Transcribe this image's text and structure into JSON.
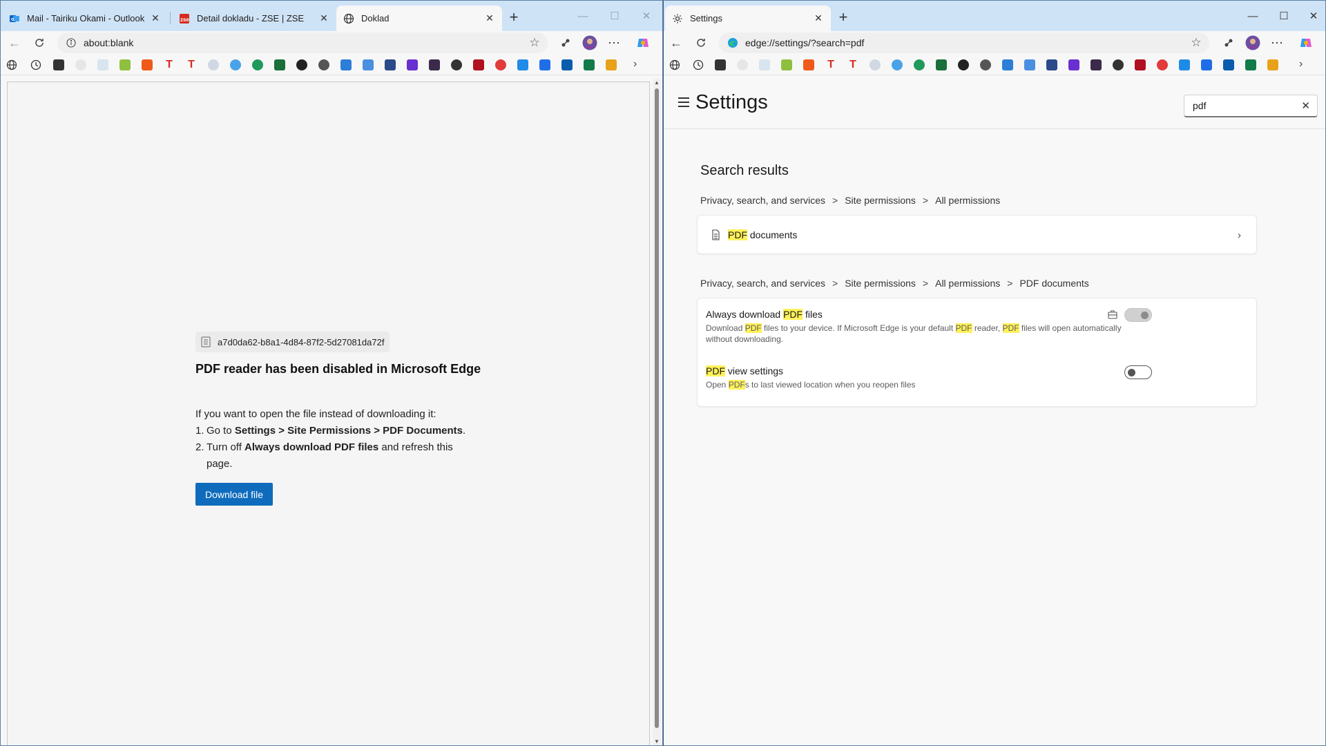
{
  "left_window": {
    "tabs": [
      {
        "title": "Mail - Tairiku Okami - Outlook",
        "icon": "outlook-icon",
        "active": false
      },
      {
        "title": "Detail dokladu - ZSE | ZSE",
        "icon": "zse-icon",
        "active": false
      },
      {
        "title": "Doklad",
        "icon": "globe-icon",
        "active": true
      }
    ],
    "address": "about:blank",
    "file_name": "a7d0da62-b8a1-4d84-87f2-5d27081da72f",
    "heading": "PDF reader has been disabled in Microsoft Edge",
    "intro": "If you want to open the file instead of downloading it:",
    "step1": {
      "num": "1.",
      "pre": "Go to ",
      "b1": "Settings",
      "s1": " > ",
      "b2": "Site Permissions",
      "s2": " > ",
      "b3": "PDF Documents",
      "end": "."
    },
    "step2": {
      "num": "2.",
      "pre": "Turn off ",
      "b1": "Always download PDF files",
      "end": " and refresh this page."
    },
    "download_button": "Download file"
  },
  "right_window": {
    "tabs": [
      {
        "title": "Settings",
        "icon": "gear-icon",
        "active": true
      }
    ],
    "address": "edge://settings/?search=pdf",
    "settings_title": "Settings",
    "search_value": "pdf",
    "results_heading": "Search results",
    "crumb1": [
      "Privacy, search, and services",
      "Site permissions",
      "All permissions"
    ],
    "crumb2": [
      "Privacy, search, and services",
      "Site permissions",
      "All permissions",
      "PDF documents"
    ],
    "crumb_separator": ">",
    "pdf_documents": {
      "hl": "PDF",
      "rest": " documents"
    },
    "always_download": {
      "label_hl": "PDF",
      "label_pre": "Always download ",
      "label_post": " files",
      "desc": [
        {
          "t": "Download ",
          "h": false
        },
        {
          "t": "PDF",
          "h": true
        },
        {
          "t": " files to your device. If Microsoft Edge is your default ",
          "h": false
        },
        {
          "t": "PDF",
          "h": true
        },
        {
          "t": " reader, ",
          "h": false
        },
        {
          "t": "PDF",
          "h": true
        },
        {
          "t": " files will open automatically without downloading.",
          "h": false
        }
      ],
      "toggle_on": true,
      "managed": true
    },
    "pdf_view": {
      "label_hl": "PDF",
      "label_post": " view settings",
      "desc": [
        {
          "t": "Open ",
          "h": false
        },
        {
          "t": "PDF",
          "h": true
        },
        {
          "t": "s to last viewed location when you reopen files",
          "h": false
        }
      ],
      "toggle_on": false
    }
  },
  "colors": {
    "tabstrip": "#cfe3f6",
    "accent_button": "#0f6cbd",
    "highlight": "#fff159"
  }
}
